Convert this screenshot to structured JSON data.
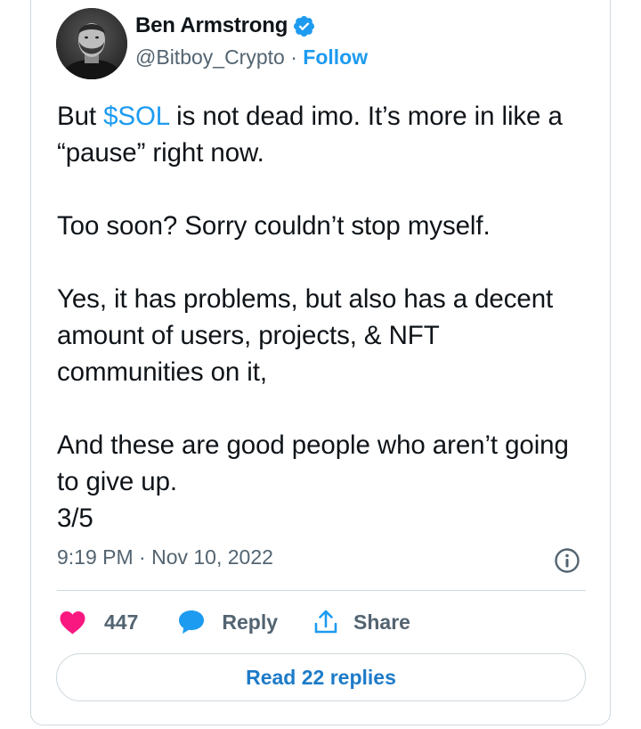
{
  "tweet": {
    "author_name": "Ben Armstrong",
    "handle": "@Bitboy_Crypto",
    "separator": " · ",
    "follow_label": "Follow",
    "text": {
      "p1_before": "But ",
      "p1_cashtag": "$SOL",
      "p1_after": " is not dead imo. It’s more in like a “pause” right now.",
      "p2": "Too soon? Sorry couldn’t stop myself.",
      "p3": "Yes, it has problems, but also has a decent amount of users, projects, & NFT communities on it,",
      "p4_line1": "And these are good people who aren’t going to give up.",
      "p4_line2": "3/5"
    },
    "timestamp": "9:19 PM · Nov 10, 2022"
  },
  "actions": {
    "like_count": "447",
    "reply_label": "Reply",
    "share_label": "Share"
  },
  "read_replies_label": "Read 22 replies",
  "colors": {
    "accent": "#1d9bf0",
    "like": "#f91880",
    "secondary_text": "#536471",
    "border": "#cfd9de"
  },
  "icons": {
    "verified": "verified-badge-icon",
    "info": "info-icon",
    "like": "heart-icon",
    "reply": "speech-bubble-icon",
    "share": "share-upload-icon"
  }
}
